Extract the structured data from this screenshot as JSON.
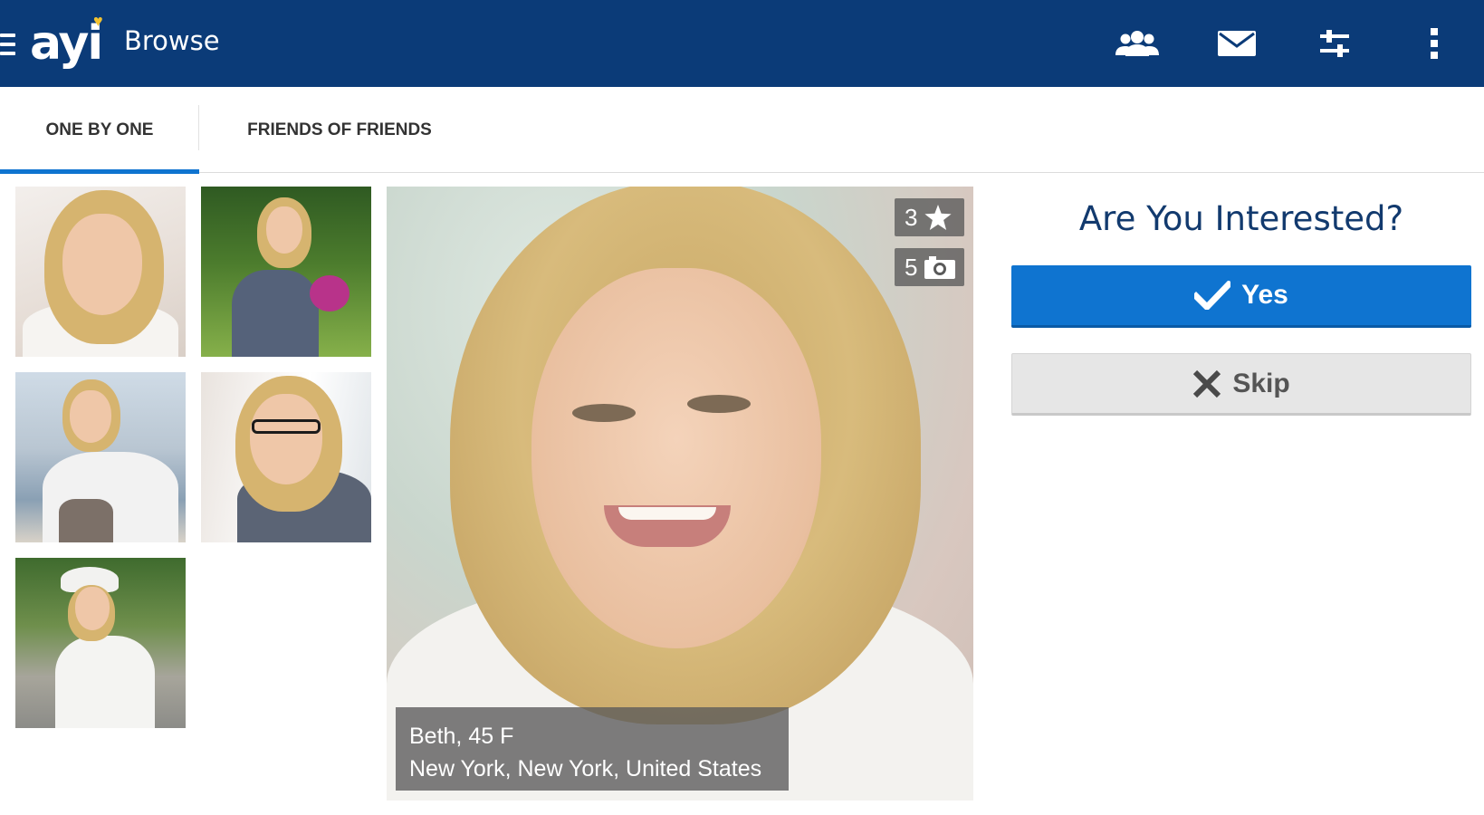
{
  "app": {
    "logo_text": "ayi",
    "title": "Browse"
  },
  "header_icons": [
    "people-icon",
    "mail-icon",
    "sliders-icon",
    "overflow-menu-icon"
  ],
  "tabs": [
    {
      "label": "ONE BY ONE",
      "active": true
    },
    {
      "label": "FRIENDS OF FRIENDS",
      "active": false
    }
  ],
  "profile": {
    "rating": "3",
    "photo_count": "5",
    "name_line": "Beth, 45 F",
    "location": "New York, New York, United States",
    "thumbnails_count": 5
  },
  "prompt": {
    "question": "Are You Interested?",
    "yes_label": "Yes",
    "skip_label": "Skip"
  },
  "colors": {
    "header_bg": "#0b3b78",
    "accent_blue": "#0f74d0",
    "heart": "#f2c230",
    "question_text": "#123a6e",
    "skip_bg": "#e6e6e6"
  }
}
